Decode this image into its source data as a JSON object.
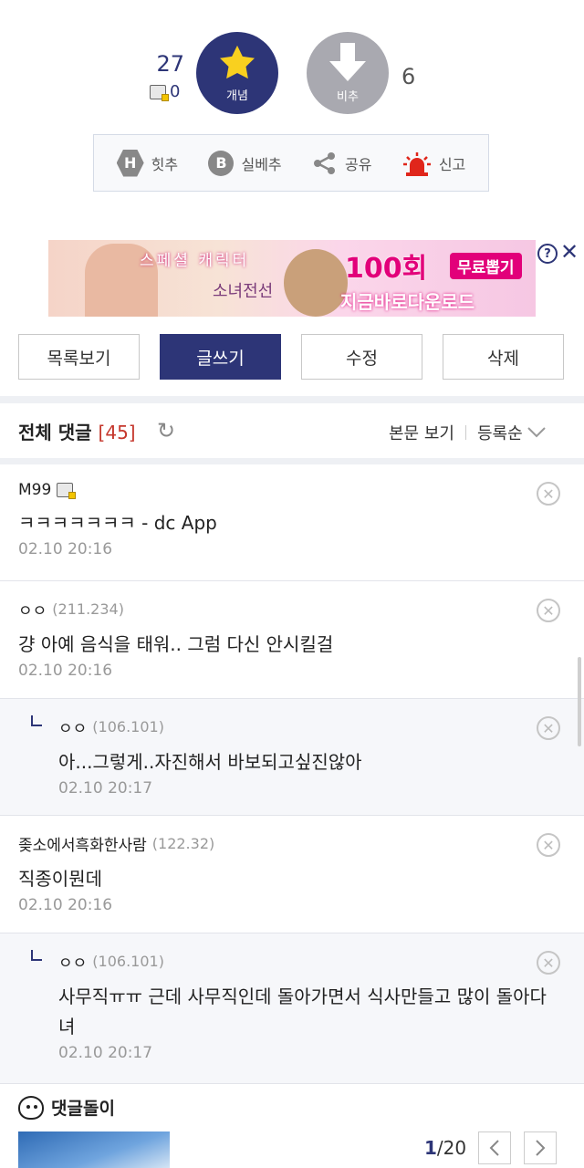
{
  "vote": {
    "up_count": "27",
    "fixed_count": "0",
    "up_label": "개념",
    "down_label": "비추",
    "down_count": "6"
  },
  "actions": [
    {
      "icon": "h-badge-icon",
      "label": "힛추"
    },
    {
      "icon": "b-badge-icon",
      "label": "실베추"
    },
    {
      "icon": "share-icon",
      "label": "공유"
    },
    {
      "icon": "siren-icon",
      "label": "신고"
    }
  ],
  "ad": {
    "line1": "스페셜 캐릭터",
    "headline": "100회",
    "badge": "무료뽑기",
    "cta": "지금바로다운로드",
    "logo": "소녀전선"
  },
  "buttons": {
    "list": "목록보기",
    "write": "글쓰기",
    "edit": "수정",
    "delete": "삭제"
  },
  "comments_header": {
    "title": "전체 댓글",
    "count": "[45]",
    "view_body": "본문 보기",
    "sort": "등록순"
  },
  "comments": [
    {
      "name": "M99",
      "ip": "",
      "body": "ㅋㅋㅋㅋㅋㅋㅋ - dc App",
      "date": "02.10 20:16",
      "reply": false
    },
    {
      "name": "ㅇㅇ",
      "ip": "(211.234)",
      "body": "걍 아예 음식을 태워.. 그럼 다신 안시킬걸",
      "date": "02.10 20:16",
      "reply": false
    },
    {
      "name": "ㅇㅇ",
      "ip": "(106.101)",
      "body": "아...그렇게..자진해서 바보되고싶진않아",
      "date": "02.10 20:17",
      "reply": true
    },
    {
      "name": "좆소에서흑화한사람",
      "ip": "(122.32)",
      "body": "직종이뭔데",
      "date": "02.10 20:16",
      "reply": false
    },
    {
      "name": "ㅇㅇ",
      "ip": "(106.101)",
      "body": "사무직ㅠㅠ 근데 사무직인데 돌아가면서 식사만들고 많이 돌아다녀",
      "date": "02.10 20:17",
      "reply": true
    }
  ],
  "bottom": {
    "title": "댓글돌이",
    "page_current": "1",
    "page_total": "/20"
  }
}
